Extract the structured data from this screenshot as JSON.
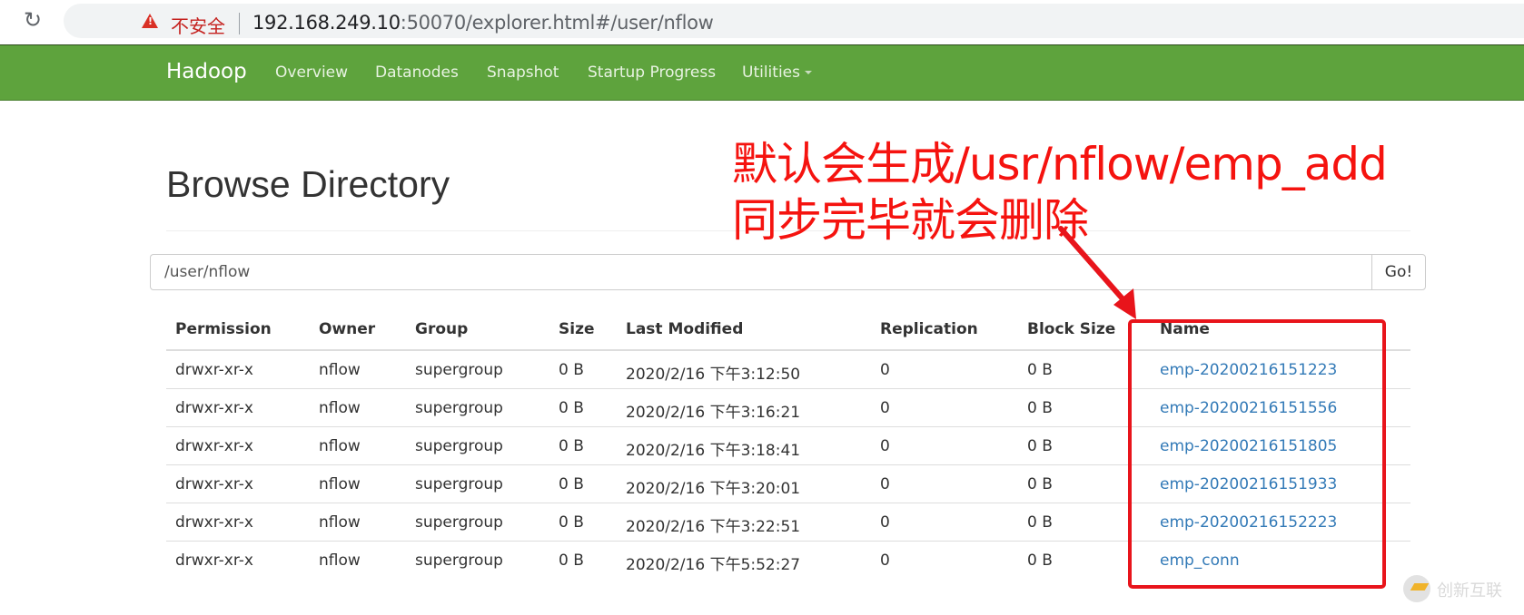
{
  "browser": {
    "reload_icon": "reload-icon",
    "security_label": "不安全",
    "url_host": "192.168.249.10",
    "url_rest": ":50070/explorer.html#/user/nflow",
    "zoom_icon": "zoom-out-icon"
  },
  "navbar": {
    "brand": "Hadoop",
    "items": [
      {
        "label": "Overview"
      },
      {
        "label": "Datanodes"
      },
      {
        "label": "Snapshot"
      },
      {
        "label": "Startup Progress"
      },
      {
        "label": "Utilities",
        "has_dropdown": true
      }
    ],
    "color": "#5ea33d"
  },
  "page": {
    "title": "Browse Directory",
    "path_value": "/user/nflow",
    "go_label": "Go!"
  },
  "table": {
    "headers": [
      "Permission",
      "Owner",
      "Group",
      "Size",
      "Last Modified",
      "Replication",
      "Block Size",
      "Name"
    ],
    "rows": [
      [
        "drwxr-xr-x",
        "nflow",
        "supergroup",
        "0 B",
        "2020/2/16 下午3:12:50",
        "0",
        "0 B",
        "emp-20200216151223"
      ],
      [
        "drwxr-xr-x",
        "nflow",
        "supergroup",
        "0 B",
        "2020/2/16 下午3:16:21",
        "0",
        "0 B",
        "emp-20200216151556"
      ],
      [
        "drwxr-xr-x",
        "nflow",
        "supergroup",
        "0 B",
        "2020/2/16 下午3:18:41",
        "0",
        "0 B",
        "emp-20200216151805"
      ],
      [
        "drwxr-xr-x",
        "nflow",
        "supergroup",
        "0 B",
        "2020/2/16 下午3:20:01",
        "0",
        "0 B",
        "emp-20200216151933"
      ],
      [
        "drwxr-xr-x",
        "nflow",
        "supergroup",
        "0 B",
        "2020/2/16 下午3:22:51",
        "0",
        "0 B",
        "emp-20200216152223"
      ],
      [
        "drwxr-xr-x",
        "nflow",
        "supergroup",
        "0 B",
        "2020/2/16 下午5:52:27",
        "0",
        "0 B",
        "emp_conn"
      ]
    ],
    "link_color": "#337ab7"
  },
  "annotation": {
    "line1": "默认会生成/usr/nflow/emp_add",
    "line2": "同步完毕就会删除",
    "color": "#f5130f"
  },
  "watermark": {
    "text": "创新互联"
  }
}
